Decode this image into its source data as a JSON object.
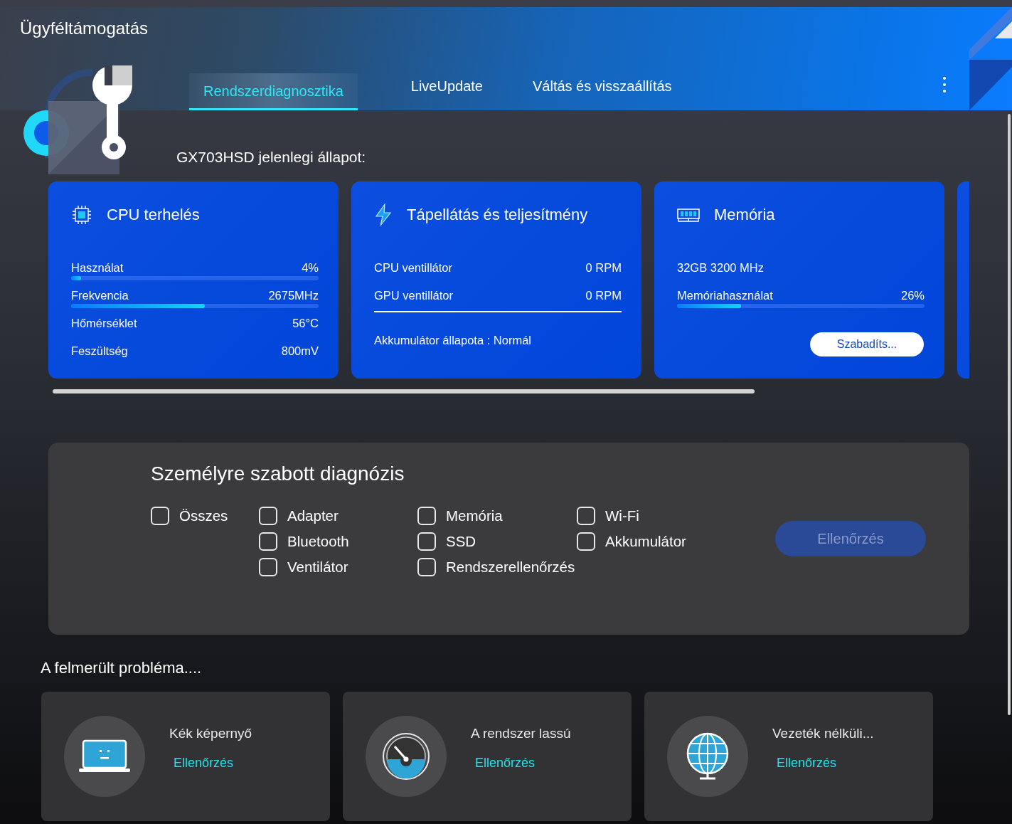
{
  "window": {
    "title": "Ügyféltámogatás"
  },
  "tabs": [
    {
      "label": "Rendszerdiagnosztika",
      "selected": true
    },
    {
      "label": "LiveUpdate",
      "selected": false
    },
    {
      "label": "Váltás és visszaállítás",
      "selected": false
    }
  ],
  "status": {
    "heading": "GX703HSD jelenlegi állapot:",
    "cards": [
      {
        "kind": "cpu",
        "title": "CPU terhelés",
        "rows": [
          {
            "kind": "metric",
            "label": "Használat",
            "value": "4%",
            "level": 0.04
          },
          {
            "kind": "metric",
            "label": "Frekvencia",
            "value": "2675MHz",
            "level": 0.54
          },
          {
            "kind": "metric",
            "label": "Hőmérséklet",
            "value": "56°C"
          },
          {
            "kind": "metric",
            "label": "Feszültség",
            "value": "800mV"
          }
        ]
      },
      {
        "kind": "power",
        "title": "Tápellátás és teljesítmény",
        "rows": [
          {
            "kind": "metric",
            "label": "CPU ventillátor",
            "value": "0 RPM"
          },
          {
            "kind": "metric",
            "label": "GPU ventillátor",
            "value": "0 RPM"
          },
          {
            "kind": "divider"
          },
          {
            "kind": "note",
            "label": "Akkumulátor állapota : Normál"
          }
        ]
      },
      {
        "kind": "memory",
        "title": "Memória",
        "rows": [
          {
            "kind": "note",
            "label": "32GB 3200 MHz"
          },
          {
            "kind": "metric",
            "label": "Memóriahasználat",
            "value": "26%",
            "level": 0.26
          }
        ],
        "button": "Szabadíts..."
      }
    ]
  },
  "diagnosis": {
    "title": "Személyre szabott diagnózis",
    "columns": [
      [
        {
          "label": "Összes",
          "checked": false
        }
      ],
      [
        {
          "label": "Adapter",
          "checked": false
        },
        {
          "label": "Bluetooth",
          "checked": false
        },
        {
          "label": "Ventilátor",
          "checked": false
        }
      ],
      [
        {
          "label": "Memória",
          "checked": false
        },
        {
          "label": "SSD",
          "checked": false
        },
        {
          "label": "Rendszerellenőrzés",
          "checked": false
        }
      ],
      [
        {
          "label": "Wi-Fi",
          "checked": false
        },
        {
          "label": "Akkumulátor",
          "checked": false
        }
      ]
    ],
    "button": {
      "label": "Ellenőrzés",
      "disabled": true
    }
  },
  "problems": {
    "heading": "A felmerült probléma....",
    "items": [
      {
        "kind": "screen",
        "title": "Kék képernyő",
        "link": "Ellenőrzés"
      },
      {
        "kind": "speed",
        "title": "A rendszer lassú",
        "link": "Ellenőrzés"
      },
      {
        "kind": "wireless",
        "title": "Vezeték nélküli...",
        "link": "Ellenőrzés"
      }
    ]
  }
}
